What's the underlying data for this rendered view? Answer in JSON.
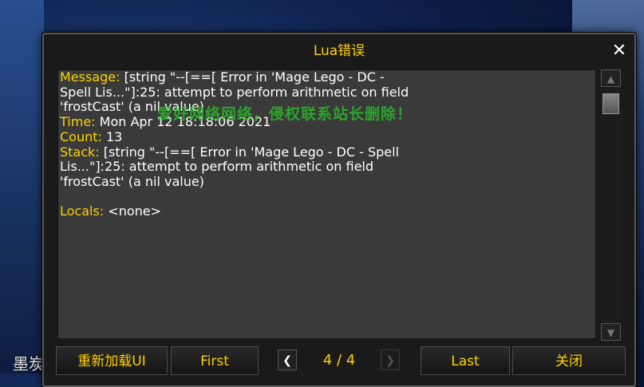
{
  "background": {
    "corner_text": "墨炭"
  },
  "window": {
    "title": "Lua错误",
    "close_glyph": "✕"
  },
  "error": {
    "lines": [
      {
        "key": "Message:",
        "text": " [string \"--[==[ Error in 'Mage Lego - DC -"
      },
      {
        "key": "",
        "text": "Spell Lis...\"]:25: attempt to perform arithmetic on field"
      },
      {
        "key": "",
        "text": "'frostCast' (a nil value)"
      },
      {
        "key": "Time:",
        "text": " Mon Apr 12 18:18:06 2021"
      },
      {
        "key": "Count:",
        "text": " 13"
      },
      {
        "key": "Stack:",
        "text": " [string \"--[==[ Error in 'Mage Lego - DC - Spell"
      },
      {
        "key": "",
        "text": "Lis...\"]:25: attempt to perform arithmetic on field"
      },
      {
        "key": "",
        "text": "'frostCast' (a nil value)"
      },
      {
        "key": "",
        "text": ""
      },
      {
        "key": "Locals:",
        "text": " <none>"
      }
    ],
    "watermark": "爱好网络网络，侵权联系站长删除！"
  },
  "scrollbar": {
    "up_glyph": "▲",
    "down_glyph": "▼"
  },
  "buttons": {
    "reload": "重新加载UI",
    "first": "First",
    "prev_glyph": "❮",
    "page": "4 / 4",
    "next_glyph": "❯",
    "last": "Last",
    "close": "关闭"
  },
  "colors": {
    "accent": "#ffd200",
    "watermark": "#28c828"
  }
}
